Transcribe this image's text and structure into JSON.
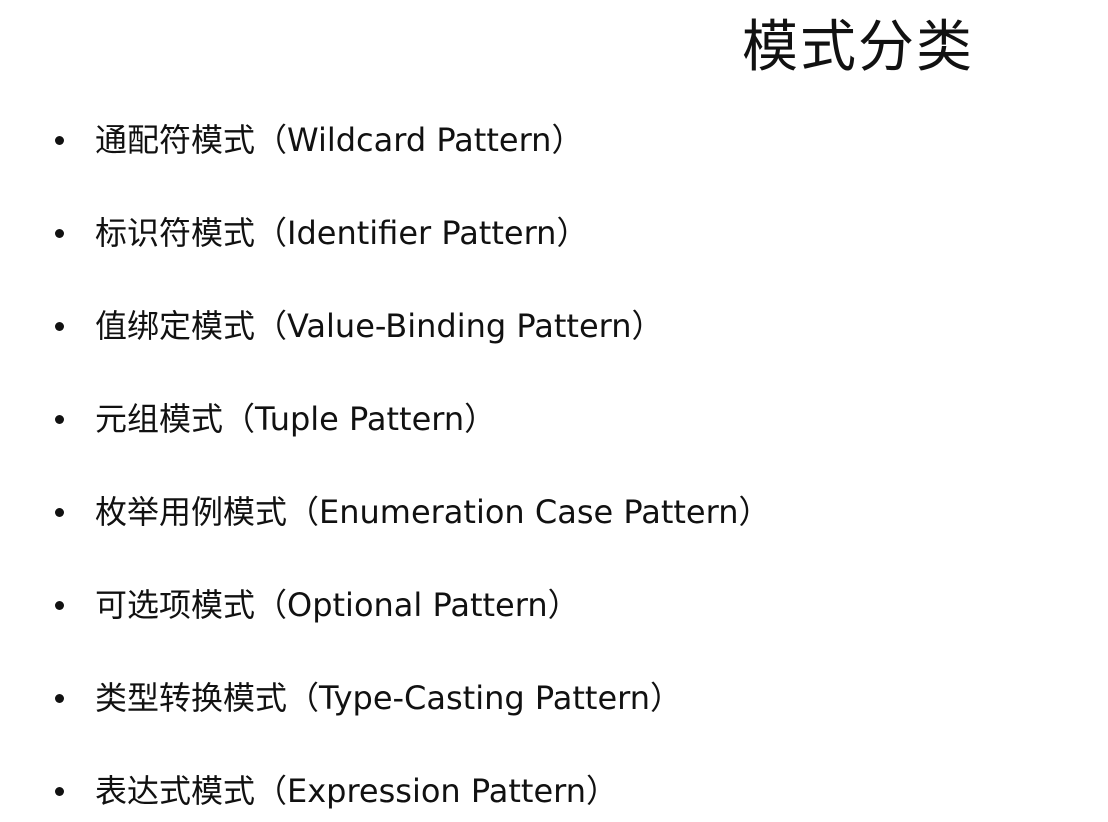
{
  "slide": {
    "title": "模式分类",
    "items": [
      "通配符模式（Wildcard Pattern）",
      "标识符模式（Identifier Pattern）",
      "值绑定模式（Value-Binding Pattern）",
      "元组模式（Tuple Pattern）",
      "枚举用例模式（Enumeration Case Pattern）",
      "可选项模式（Optional Pattern）",
      "类型转换模式（Type-Casting Pattern）",
      "表达式模式（Expression Pattern）"
    ]
  },
  "colors": {
    "background": "#ffffff",
    "text": "#111111"
  }
}
